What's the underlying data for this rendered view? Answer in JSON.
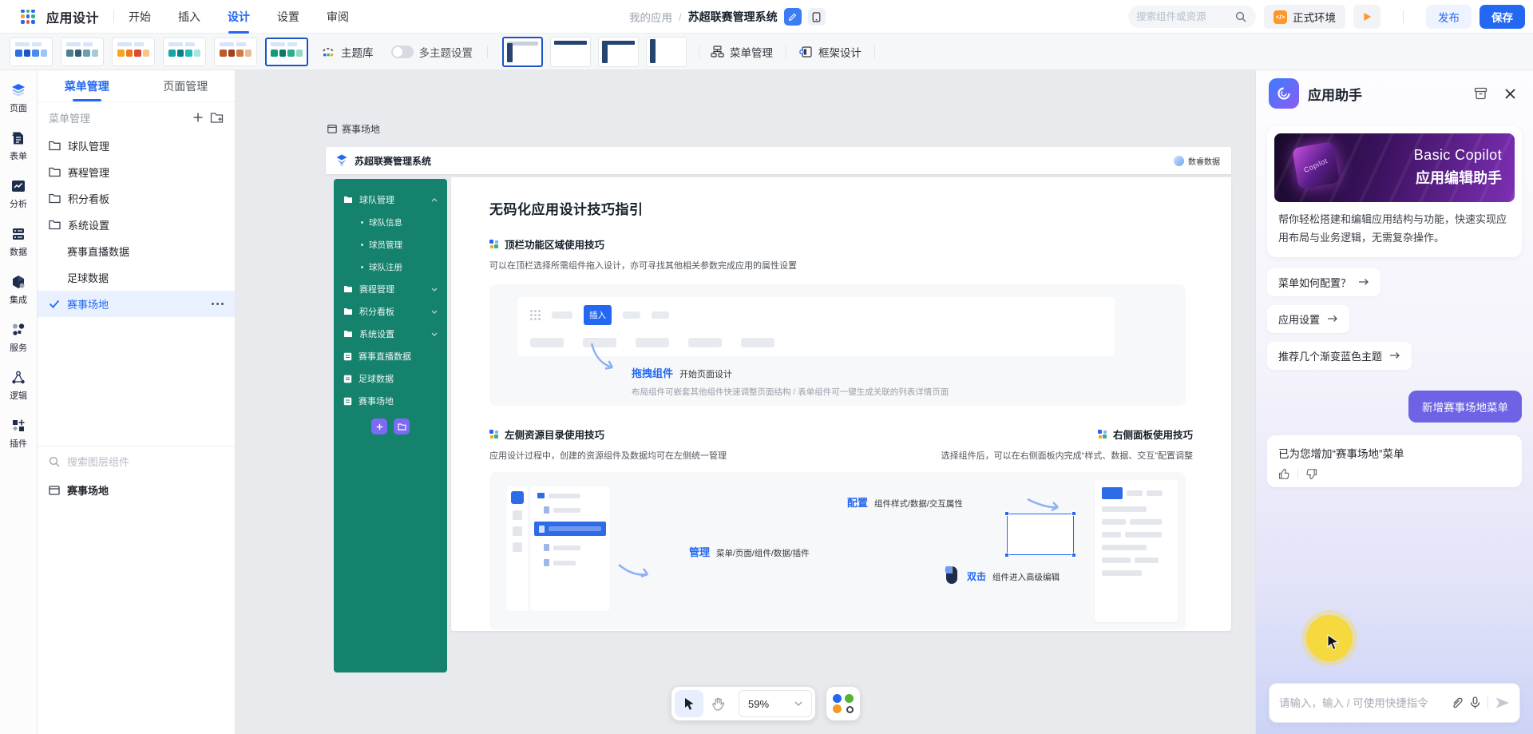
{
  "topbar": {
    "app_title": "应用设计",
    "menus": [
      {
        "label": "开始"
      },
      {
        "label": "插入"
      },
      {
        "label": "设计"
      },
      {
        "label": "设置"
      },
      {
        "label": "审阅"
      }
    ],
    "active_menu": "设计",
    "breadcrumb": {
      "parent": "我的应用",
      "sep": "/",
      "current": "苏超联赛管理系统"
    },
    "search_placeholder": "搜索组件或资源",
    "env_button": "正式环境",
    "publish_button": "发布",
    "save_button": "保存"
  },
  "toolbar": {
    "swatches": [
      {
        "selected": false,
        "colors": [
          "#2f6fe4",
          "#1e54c8",
          "#4a8bf0",
          "#9dc3f7"
        ]
      },
      {
        "selected": false,
        "colors": [
          "#4f7e8f",
          "#2f6173",
          "#6e9eae",
          "#a8c9d4"
        ]
      },
      {
        "selected": false,
        "colors": [
          "#f6a51f",
          "#ee7b1e",
          "#dd4a2c",
          "#f7c789"
        ]
      },
      {
        "selected": false,
        "colors": [
          "#16a5a5",
          "#0a7e8c",
          "#27bbb5",
          "#a5e6e0"
        ]
      },
      {
        "selected": false,
        "colors": [
          "#bf5b2a",
          "#9e431d",
          "#d07b45",
          "#e9bc96"
        ]
      },
      {
        "selected": true,
        "colors": [
          "#16997c",
          "#0a7a63",
          "#2bae8e",
          "#93d9c4"
        ]
      }
    ],
    "theme_library": "主题库",
    "multi_theme": "多主题设置",
    "multi_theme_on": false,
    "frame_options": {
      "count": 4,
      "selected_index": 0
    },
    "menu_management": "菜单管理",
    "frame_design": "框架设计"
  },
  "rail": {
    "items": [
      {
        "label": "页面"
      },
      {
        "label": "表单"
      },
      {
        "label": "分析"
      },
      {
        "label": "数据"
      },
      {
        "label": "集成"
      },
      {
        "label": "服务"
      },
      {
        "label": "逻辑"
      },
      {
        "label": "插件"
      }
    ]
  },
  "left_panel": {
    "tabs": [
      {
        "label": "菜单管理"
      },
      {
        "label": "页面管理"
      }
    ],
    "active_tab": "菜单管理",
    "tree_title": "菜单管理",
    "tree": [
      {
        "label": "球队管理",
        "type": "folder"
      },
      {
        "label": "赛程管理",
        "type": "folder"
      },
      {
        "label": "积分看板",
        "type": "folder"
      },
      {
        "label": "系统设置",
        "type": "folder"
      },
      {
        "label": "赛事直播数据",
        "type": "page"
      },
      {
        "label": "足球数据",
        "type": "page"
      },
      {
        "label": "赛事场地",
        "type": "page",
        "selected": true
      }
    ],
    "layer_search_placeholder": "搜索图层组件",
    "layer_item": "赛事场地"
  },
  "canvas": {
    "page_tab": "赛事场地",
    "zoom_value": "59%",
    "preview": {
      "brand": "苏超联赛管理系统",
      "badge": "数睿数据",
      "menu": {
        "groups": [
          {
            "label": "球队管理",
            "expanded": true,
            "children": [
              {
                "label": "球队信息"
              },
              {
                "label": "球员管理"
              },
              {
                "label": "球队注册"
              }
            ]
          },
          {
            "label": "赛程管理",
            "expanded": false
          },
          {
            "label": "积分看板",
            "expanded": false
          },
          {
            "label": "系统设置",
            "expanded": false
          }
        ],
        "pages": [
          {
            "label": "赛事直播数据"
          },
          {
            "label": "足球数据"
          },
          {
            "label": "赛事场地"
          }
        ]
      },
      "content": {
        "title": "无码化应用设计技巧指引",
        "top_section": {
          "heading": "顶栏功能区域使用技巧",
          "desc": "可以在顶栏选择所需组件拖入设计，亦可寻找其他相关参数完成应用的属性设置",
          "mini_button": "插入",
          "callout": "拖拽组件",
          "callout_sub": "开始页面设计",
          "note": "布局组件可嵌套其他组件快速调整页面结构 / 表单组件可一键生成关联的列表详情页面"
        },
        "left_section": {
          "heading": "左侧资源目录使用技巧",
          "desc": "应用设计过程中，创建的资源组件及数据均可在左侧统一管理",
          "callout": "管理",
          "callout_sub": "菜单/页面/组件/数据/插件"
        },
        "right_section": {
          "heading": "右侧面板使用技巧",
          "desc": "选择组件后，可以在右侧面板内完成“样式、数据、交互”配置调整",
          "callout": "配置",
          "callout_sub": "组件样式/数据/交互属性",
          "extra": "双击",
          "extra_sub": "组件进入高级编辑"
        }
      }
    }
  },
  "assistant": {
    "title": "应用助手",
    "banner": {
      "line1": "Basic Copilot",
      "line2": "应用编辑助手",
      "cube_label": "Copilot"
    },
    "desc": "帮你轻松搭建和编辑应用结构与功能，快速实现应用布局与业务逻辑，无需复杂操作。",
    "chips": [
      {
        "label": "菜单如何配置？"
      },
      {
        "label": "应用设置"
      },
      {
        "label": "推荐几个渐变蓝色主题"
      }
    ],
    "user_message": "新增赛事场地菜单",
    "bot_message": "已为您增加“赛事场地”菜单",
    "input_placeholder": "请输入，输入 / 可使用快捷指令"
  },
  "colors": {
    "accent": "#2468f2",
    "sidebar_green": "#15826e",
    "assistant_purple": "#6e62e5",
    "selected_border": "#1a53c4",
    "warning_orange": "#ff9626",
    "highlight_yellow": "#f5d93f"
  }
}
